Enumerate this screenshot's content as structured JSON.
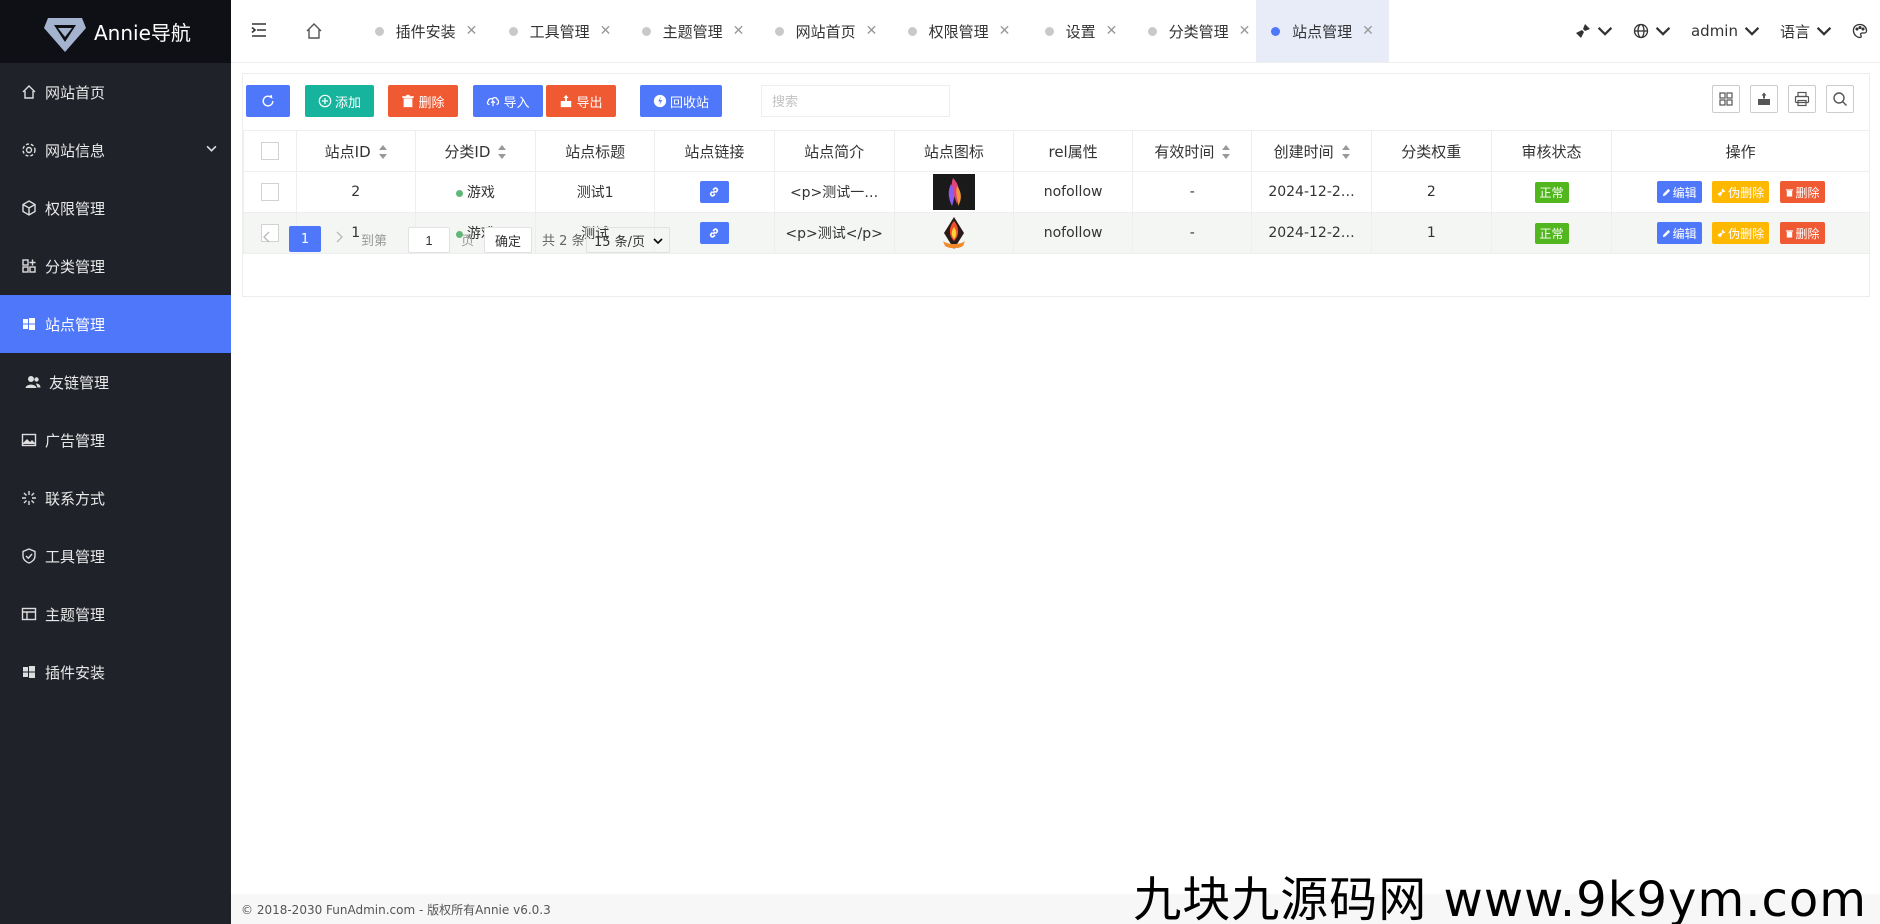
{
  "brand": {
    "name": "Annie导航"
  },
  "sidebar": {
    "items": [
      {
        "label": "网站首页",
        "icon": "home-icon"
      },
      {
        "label": "网站信息",
        "icon": "gear-icon",
        "has_children": true
      },
      {
        "label": "权限管理",
        "icon": "cube-icon"
      },
      {
        "label": "分类管理",
        "icon": "grid-icon"
      },
      {
        "label": "站点管理",
        "icon": "windows-icon",
        "active": true
      },
      {
        "label": "友链管理",
        "icon": "users-icon"
      },
      {
        "label": "广告管理",
        "icon": "image-icon"
      },
      {
        "label": "联系方式",
        "icon": "sparkle-icon"
      },
      {
        "label": "工具管理",
        "icon": "shield-icon"
      },
      {
        "label": "主题管理",
        "icon": "table-icon"
      },
      {
        "label": "插件安装",
        "icon": "windows-icon"
      }
    ]
  },
  "tabs": [
    {
      "label": "插件安装"
    },
    {
      "label": "工具管理"
    },
    {
      "label": "主题管理"
    },
    {
      "label": "网站首页"
    },
    {
      "label": "权限管理"
    },
    {
      "label": "设置"
    },
    {
      "label": "分类管理"
    },
    {
      "label": "站点管理",
      "active": true
    }
  ],
  "header_right": {
    "user": "admin",
    "language": "语言"
  },
  "toolbar": {
    "refresh": "",
    "add": "添加",
    "delete": "删除",
    "import": "导入",
    "export": "导出",
    "recycle": "回收站",
    "search_placeholder": "搜索"
  },
  "table": {
    "columns": [
      "站点ID",
      "分类ID",
      "站点标题",
      "站点链接",
      "站点简介",
      "站点图标",
      "rel属性",
      "有效时间",
      "创建时间",
      "分类权重",
      "审核状态",
      "操作"
    ],
    "rows": [
      {
        "id": "2",
        "category": "游戏",
        "title": "测试1",
        "intro": "<p>测试一…",
        "rel": "nofollow",
        "valid": "-",
        "created": "2024-12-2…",
        "weight": "2",
        "status": "正常"
      },
      {
        "id": "1",
        "category": "游戏",
        "title": "测试",
        "intro": "<p>测试</p>",
        "rel": "nofollow",
        "valid": "-",
        "created": "2024-12-2…",
        "weight": "1",
        "status": "正常"
      }
    ],
    "row_actions": {
      "edit": "编辑",
      "soft_delete": "伪删除",
      "delete": "删除"
    }
  },
  "pagination": {
    "current": "1",
    "goto_prefix": "到第",
    "goto_value": "1",
    "goto_suffix": "页",
    "confirm": "确定",
    "total": "共 2 条",
    "page_size": "15 条/页"
  },
  "footer": {
    "text": "© 2018-2030 FunAdmin.com - 版权所有Annie v6.0.3"
  },
  "watermark": {
    "text": "九块九源码网 www.9k9ym.com"
  },
  "colors": {
    "sidebar_bg": "#20222a",
    "accent": "#4f77fa",
    "teal": "#16b49d",
    "red": "#f05a33",
    "yellow": "#ffb800",
    "green": "#52b71e"
  }
}
